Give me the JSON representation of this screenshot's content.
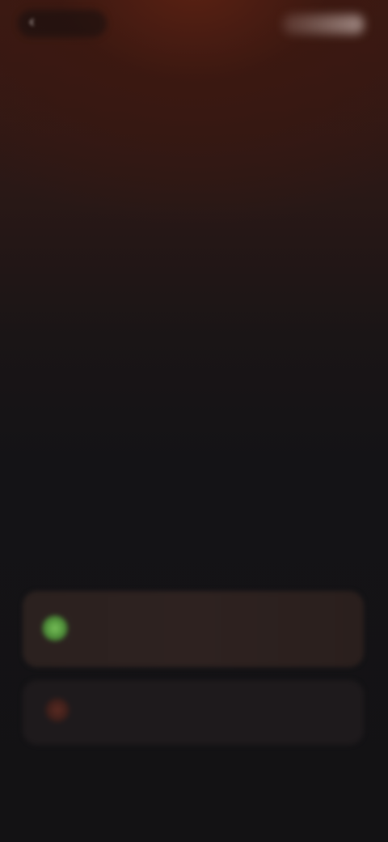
{
  "header": {
    "back_icon": "chevron-left-icon",
    "title": ""
  },
  "content": {
    "eyebrow": "",
    "headline": "",
    "description": ""
  },
  "options": [
    {
      "icon": "status-dot-icon",
      "label": "",
      "color": "#79c25a"
    },
    {
      "icon": "status-dot-icon",
      "label": "",
      "color": "#5c2b22"
    }
  ],
  "colors": {
    "background": "#131214",
    "accent": "#c46038",
    "glow": "#5a2113"
  }
}
